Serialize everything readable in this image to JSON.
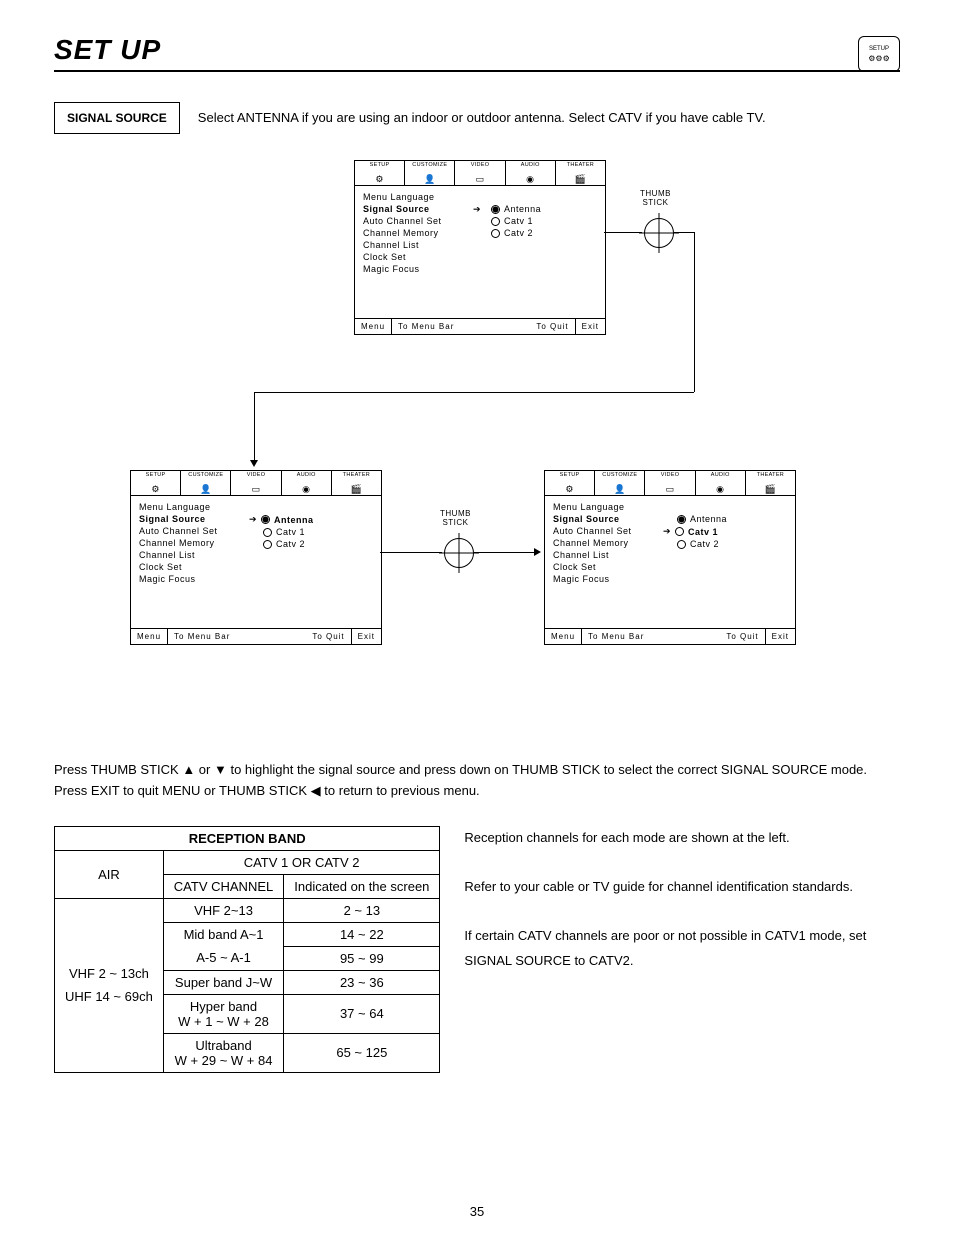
{
  "pageNumber": "35",
  "title": "SET UP",
  "signalBox": "SIGNAL SOURCE",
  "intro": "Select ANTENNA if you are using an indoor or outdoor antenna.  Select CATV if you have cable TV.",
  "cornerLabel": "SETUP",
  "tabs": [
    "SETUP",
    "CUSTOMIZE",
    "VIDEO",
    "AUDIO",
    "THEATER"
  ],
  "menuItems": [
    "Menu Language",
    "Signal Source",
    "Auto Channel Set",
    "Channel Memory",
    "Channel List",
    "Clock Set",
    "Magic Focus"
  ],
  "options": [
    "Antenna",
    "Catv 1",
    "Catv 2"
  ],
  "foot": {
    "menu": "Menu",
    "tomb": "To Menu Bar",
    "tq": "To Quit",
    "exit": "Exit"
  },
  "thumb": "THUMB\nSTICK",
  "instr1": "Press THUMB STICK ▲ or ▼ to highlight the signal source and press down on THUMB STICK to select the correct SIGNAL SOURCE mode.",
  "instr2": "Press EXIT to quit MENU or THUMB STICK ◀ to return to previous menu.",
  "rbTitle": "RECEPTION BAND",
  "rb": {
    "h1": "AIR",
    "h2": "CATV 1 OR CATV 2",
    "h3": "CATV CHANNEL",
    "h4": "Indicated on the screen",
    "air1": "VHF 2 ~ 13ch",
    "air2": "UHF 14 ~ 69ch",
    "rows": [
      {
        "c": "VHF 2~13",
        "s": "2 ~ 13"
      },
      {
        "c": "Mid band A~1",
        "s": "14 ~ 22"
      },
      {
        "c": "A-5 ~ A-1",
        "s": "95 ~ 99"
      },
      {
        "c": "Super band J~W",
        "s": "23 ~ 36"
      },
      {
        "c": "Hyper band",
        "s": ""
      },
      {
        "c": "W + 1 ~ W + 28",
        "s": "37 ~ 64"
      },
      {
        "c": "Ultraband",
        "s": ""
      },
      {
        "c": "W + 29 ~ W + 84",
        "s": "65 ~ 125"
      }
    ]
  },
  "notes": [
    "Reception channels for each mode are shown at the left.",
    "Refer to your cable or TV guide for channel identification standards.",
    "If certain CATV channels are poor or not possible in CATV1 mode, set SIGNAL SOURCE to CATV2."
  ]
}
